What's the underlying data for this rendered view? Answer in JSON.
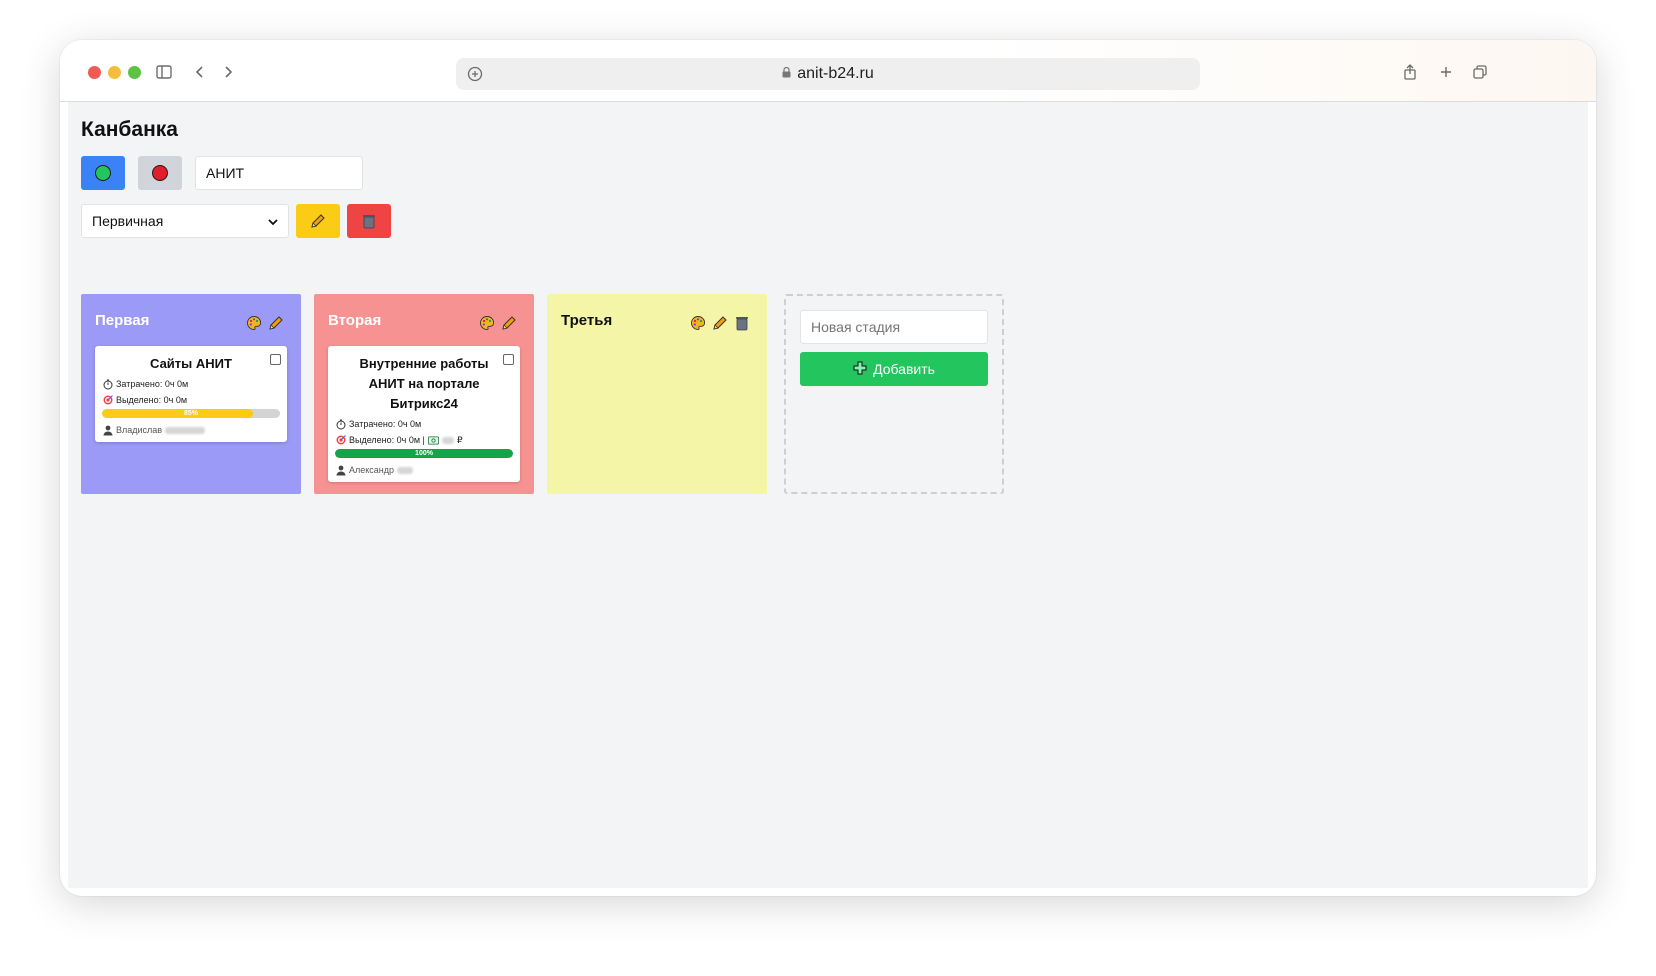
{
  "browser": {
    "url": "anit-b24.ru"
  },
  "page": {
    "title": "Канбанка"
  },
  "controls": {
    "project_input_value": "АНИТ",
    "board_select_value": "Первичная"
  },
  "columns": [
    {
      "title": "Первая",
      "color": "#9b9af7",
      "card": {
        "title": "Сайты АНИТ",
        "spent": "Затрачено: 0ч 0м",
        "allocated": "Выделено: 0ч 0м",
        "progress_label": "85%",
        "progress": 85,
        "progress_color": "#facc15",
        "assignee": "Владислав"
      }
    },
    {
      "title": "Вторая",
      "color": "#f79292",
      "card": {
        "title": "Внутренние работы АНИТ на портале Битрикс24",
        "spent": "Затрачено: 0ч 0м",
        "allocated": "Выделено: 0ч 0м |",
        "currency": "₽",
        "progress_label": "100%",
        "progress": 100,
        "progress_color": "#16a34a",
        "assignee": "Александр"
      }
    },
    {
      "title": "Третья",
      "color": "#f5f5a7"
    }
  ],
  "new_stage": {
    "placeholder": "Новая стадия",
    "add_label": "Добавить"
  }
}
